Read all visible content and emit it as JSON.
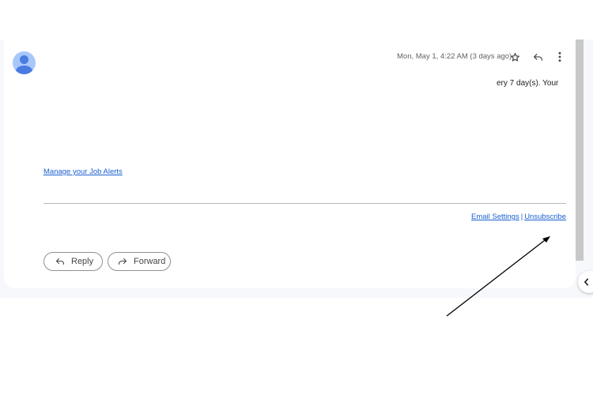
{
  "message": {
    "date": "Mon, May 1, 4:22 AM (3 days ago)",
    "snippet": "ery 7 day(s). Your",
    "manage_link": "Manage your Job Alerts",
    "footer_links": [
      {
        "label": "Email Settings"
      },
      {
        "label": "Unsubscribe"
      }
    ],
    "footer_separator": "|"
  },
  "actions": {
    "reply_label": "Reply",
    "forward_label": "Forward"
  },
  "icons": {
    "star": "star-icon",
    "reply": "reply-icon",
    "more": "more-vert-icon",
    "collapse": "chevron-left-icon",
    "avatar": "person-icon"
  },
  "colors": {
    "link": "#1a5fd0",
    "avatar_bg": "#a8c7fa",
    "avatar_fg": "#4a7be0",
    "band": "#f6f8fc"
  }
}
